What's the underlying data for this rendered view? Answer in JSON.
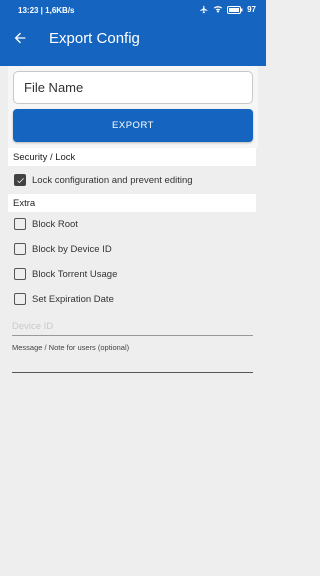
{
  "status_bar": {
    "time_speed": "13:23 | 1,6KB/s",
    "battery": "97",
    "icons": [
      "airplane-icon",
      "wifi-icon",
      "battery-icon"
    ]
  },
  "app_bar": {
    "title": "Export Config",
    "back_icon": "arrow-back-icon"
  },
  "form": {
    "file_name_placeholder": "File Name",
    "export_label": "EXPORT"
  },
  "sections": {
    "security_title": "Security / Lock",
    "extra_title": "Extra"
  },
  "security_options": [
    {
      "label": "Lock configuration and prevent editing",
      "checked": true
    }
  ],
  "extra_options": [
    {
      "label": "Block Root",
      "checked": false
    },
    {
      "label": "Block by Device ID",
      "checked": false
    },
    {
      "label": "Block Torrent Usage",
      "checked": false
    },
    {
      "label": "Set Expiration Date",
      "checked": false
    }
  ],
  "fields": {
    "device_id_placeholder": "Device ID",
    "message_label": "Message / Note for users (optional)",
    "message_value": ""
  },
  "colors": {
    "primary": "#1565c0",
    "background": "#eeeeee",
    "checkbox_checked": "#424242"
  }
}
